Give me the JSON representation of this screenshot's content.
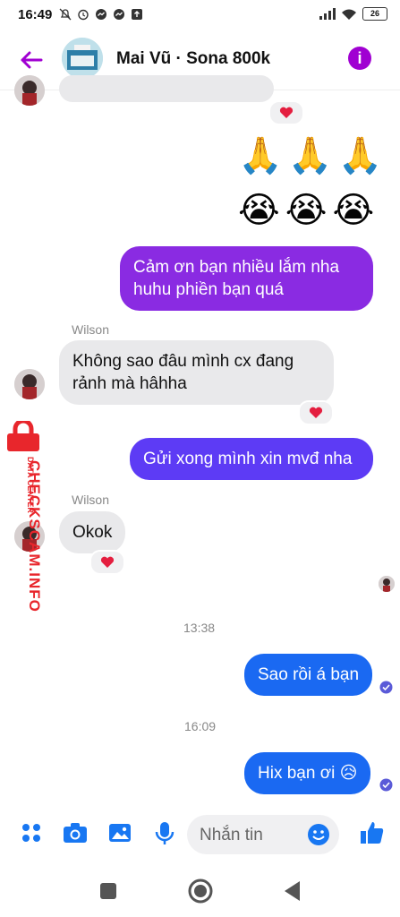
{
  "status_bar": {
    "time": "16:49",
    "battery": "26"
  },
  "header": {
    "title": "Mai Vũ · Sona 800k"
  },
  "messages": {
    "emoji_pray": "🙏🙏🙏",
    "emoji_cry": "😭😭😭",
    "m1": "Cảm ơn bạn nhiều lắm nha huhu phiền bạn quá",
    "sender1": "Wilson",
    "m2": "Không sao đâu mình cx đang rảnh mà hâhha",
    "m3": "Gửi xong mình xin mvđ nha",
    "sender2": "Wilson",
    "m4": "Okok",
    "ts1": "13:38",
    "m5": "Sao rồi á bạn",
    "ts2": "16:09",
    "m6": "Hix bạn ơi 😥",
    "reaction": "❤️"
  },
  "composer": {
    "placeholder": "Nhắn tin"
  },
  "watermark": {
    "brand": "CHECKSCAM.INFO",
    "sub": "DATA CENTER"
  },
  "colors": {
    "accent": "#a000d2",
    "purple": "#8a2be2",
    "violet": "#5d3bf5",
    "blue": "#1a69f2",
    "icon_blue": "#1877f2"
  }
}
